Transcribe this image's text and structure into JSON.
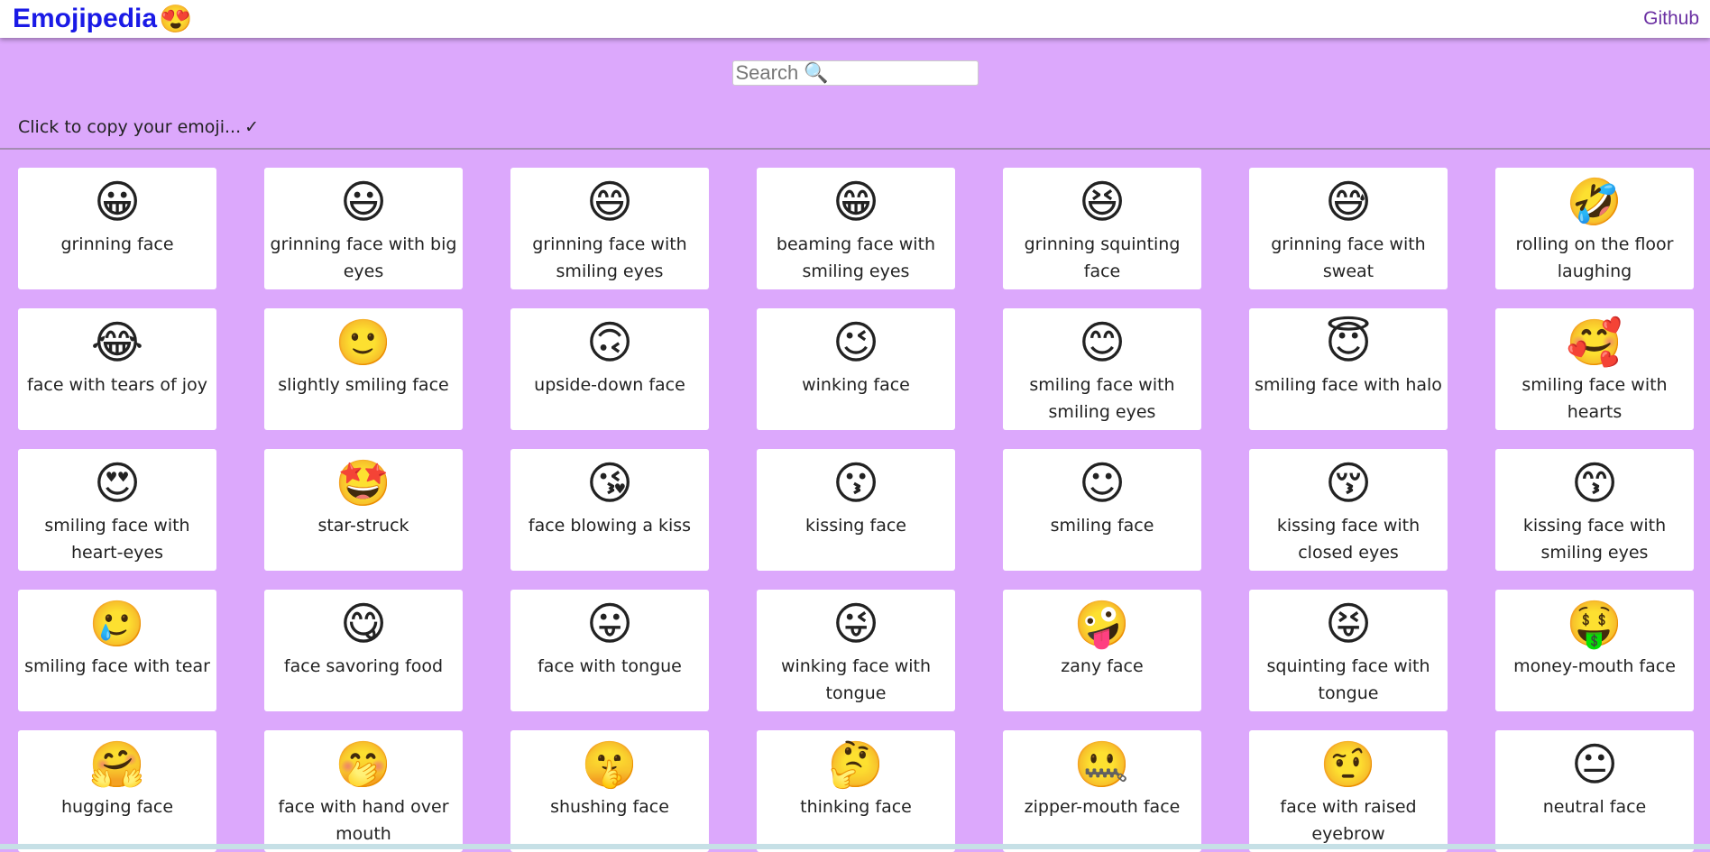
{
  "header": {
    "brand": "Emojipedia",
    "brand_emoji": "😍",
    "github_link": "Github"
  },
  "search": {
    "placeholder": "Search 🔍"
  },
  "hint": {
    "text": "Click to copy your emoji...",
    "check": "✓"
  },
  "colors": {
    "background": "#dca8fc",
    "brand": "#1a1ae6",
    "github": "#6a2fa2",
    "card": "#ffffff"
  },
  "emojis": [
    {
      "char": "😀",
      "name": "grinning face"
    },
    {
      "char": "😃",
      "name": "grinning face with big eyes"
    },
    {
      "char": "😄",
      "name": "grinning face with smiling eyes"
    },
    {
      "char": "😁",
      "name": "beaming face with smiling eyes"
    },
    {
      "char": "😆",
      "name": "grinning squinting face"
    },
    {
      "char": "😅",
      "name": "grinning face with sweat"
    },
    {
      "char": "🤣",
      "name": "rolling on the floor laughing"
    },
    {
      "char": "😂",
      "name": "face with tears of joy"
    },
    {
      "char": "🙂",
      "name": "slightly smiling face"
    },
    {
      "char": "🙃",
      "name": "upside-down face"
    },
    {
      "char": "😉",
      "name": "winking face"
    },
    {
      "char": "😊",
      "name": "smiling face with smiling eyes"
    },
    {
      "char": "😇",
      "name": "smiling face with halo"
    },
    {
      "char": "🥰",
      "name": "smiling face with hearts"
    },
    {
      "char": "😍",
      "name": "smiling face with heart-eyes"
    },
    {
      "char": "🤩",
      "name": "star-struck"
    },
    {
      "char": "😘",
      "name": "face blowing a kiss"
    },
    {
      "char": "😗",
      "name": "kissing face"
    },
    {
      "char": "☺",
      "name": "smiling face"
    },
    {
      "char": "😚",
      "name": "kissing face with closed eyes"
    },
    {
      "char": "😙",
      "name": "kissing face with smiling eyes"
    },
    {
      "char": "🥲",
      "name": "smiling face with tear"
    },
    {
      "char": "😋",
      "name": "face savoring food"
    },
    {
      "char": "😛",
      "name": "face with tongue"
    },
    {
      "char": "😜",
      "name": "winking face with tongue"
    },
    {
      "char": "🤪",
      "name": "zany face"
    },
    {
      "char": "😝",
      "name": "squinting face with tongue"
    },
    {
      "char": "🤑",
      "name": "money-mouth face"
    },
    {
      "char": "🤗",
      "name": "hugging face"
    },
    {
      "char": "🤭",
      "name": "face with hand over mouth"
    },
    {
      "char": "🤫",
      "name": "shushing face"
    },
    {
      "char": "🤔",
      "name": "thinking face"
    },
    {
      "char": "🤐",
      "name": "zipper-mouth face"
    },
    {
      "char": "🤨",
      "name": "face with raised eyebrow"
    },
    {
      "char": "😐",
      "name": "neutral face"
    }
  ]
}
